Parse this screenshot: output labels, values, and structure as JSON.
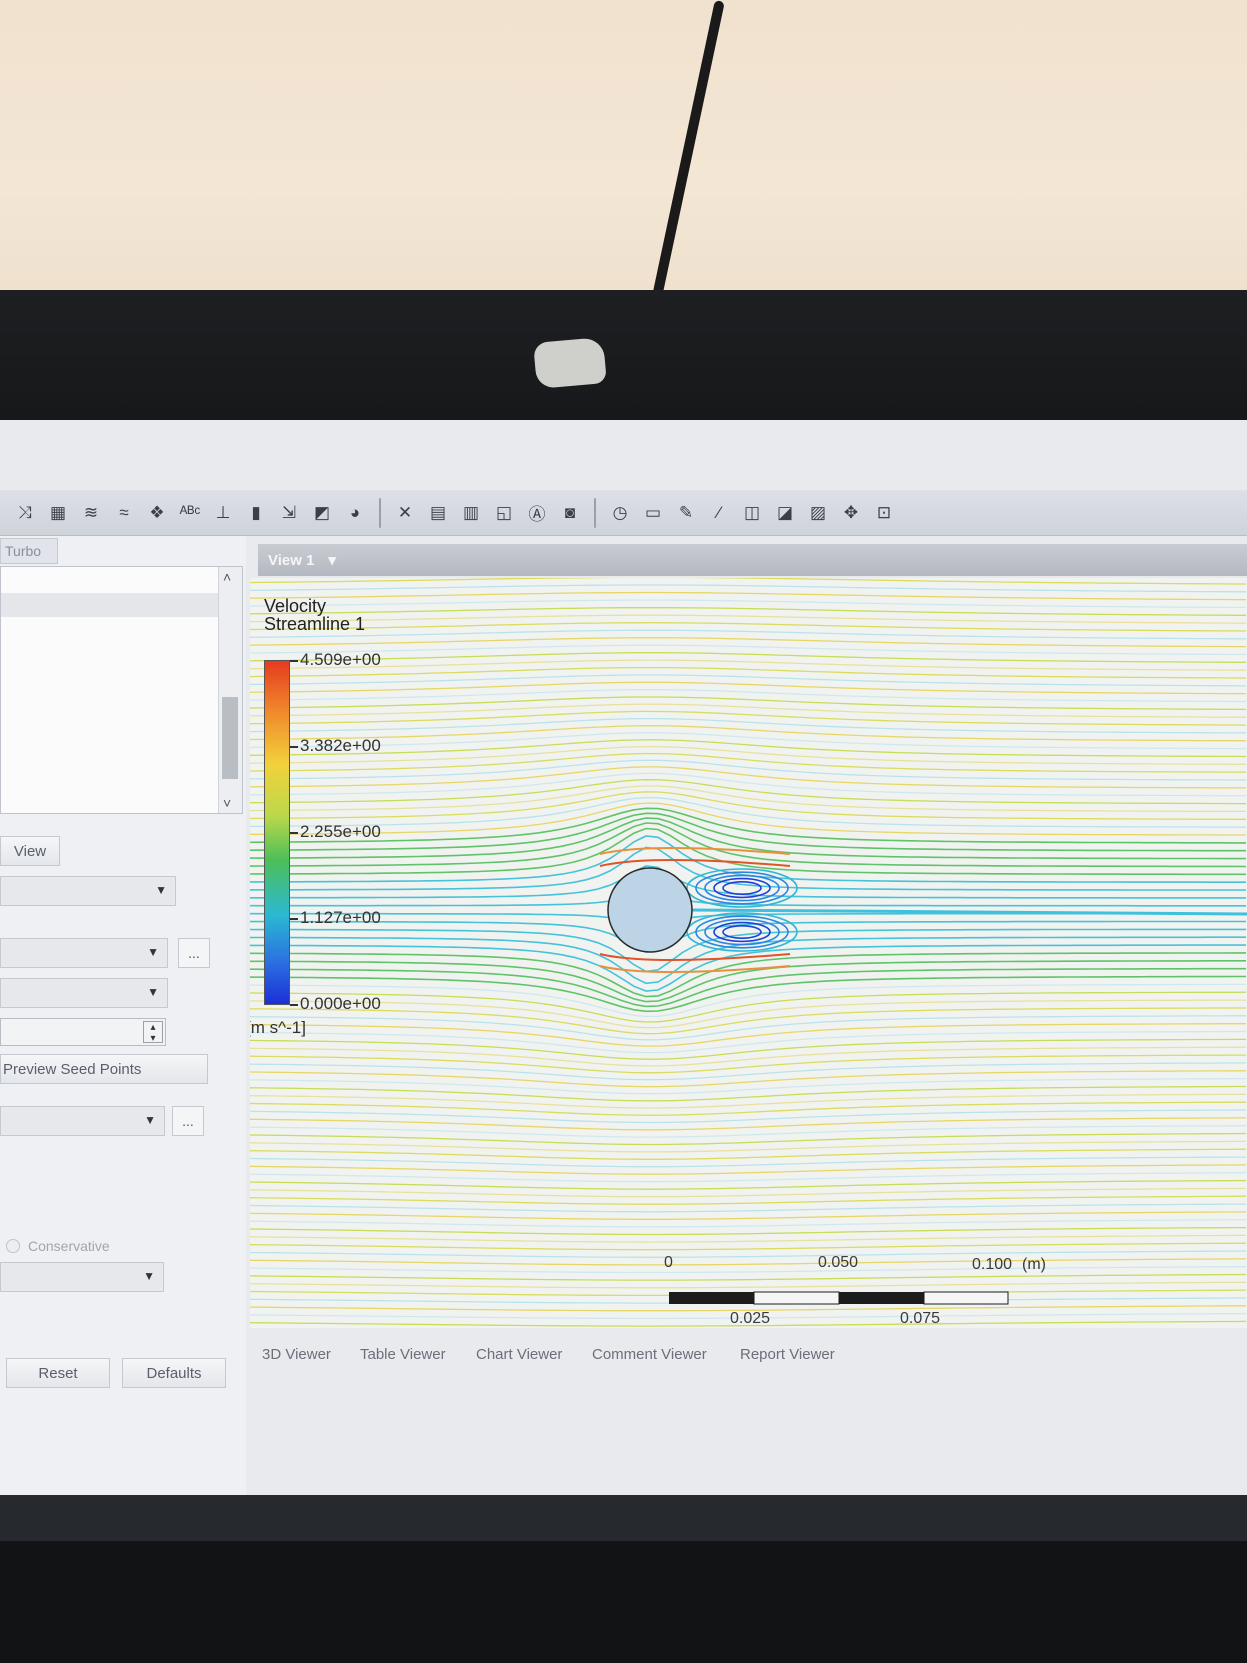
{
  "left_panel": {
    "tab": "Turbo",
    "view_button": "View",
    "preview_seed_points": "Preview Seed Points",
    "conservative": "Conservative",
    "reset": "Reset",
    "defaults": "Defaults",
    "ellipsis": "..."
  },
  "viewport": {
    "tab_label": "View 1",
    "legend": {
      "variable": "Velocity",
      "object": "Streamline 1",
      "max": "4.509e+00",
      "v3": "3.382e+00",
      "v2": "2.255e+00",
      "v1": "1.127e+00",
      "min": "0.000e+00",
      "unit": "[m s^-1]"
    },
    "scale": {
      "zero": "0",
      "mid_top": "0.050",
      "end_top": "0.100",
      "unit": "(m)",
      "q1": "0.025",
      "q3": "0.075"
    }
  },
  "viewer_tabs": [
    "3D Viewer",
    "Table Viewer",
    "Chart Viewer",
    "Comment Viewer",
    "Report Viewer"
  ],
  "toolbar_help": "?"
}
